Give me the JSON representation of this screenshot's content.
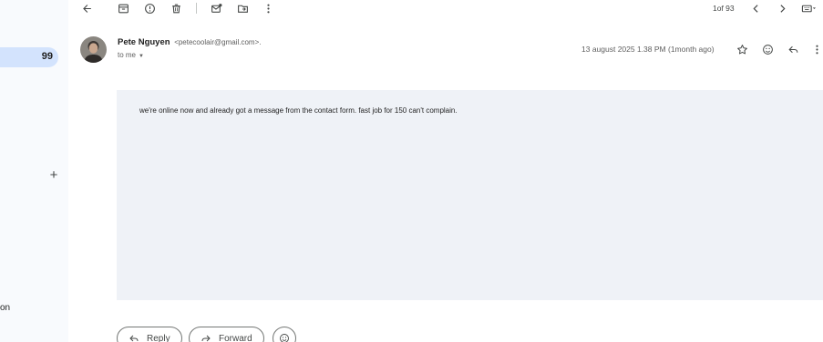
{
  "sidebar": {
    "inbox_count": "99",
    "add_label_glyph": "+",
    "fragment_text": "on"
  },
  "toolbar": {
    "back_icon": "arrow-left-icon",
    "archive_icon": "archive-icon",
    "spam_icon": "report-spam-icon",
    "delete_icon": "trash-icon",
    "mark_unread_icon": "mark-unread-icon",
    "move_icon": "move-to-icon",
    "more_icon": "more-vert-icon",
    "pager_text": "1of 93"
  },
  "email": {
    "sender_name": "Pete Nguyen",
    "sender_email": "<petecoolair@gmail.com>.",
    "to_line": "to me",
    "date": "13 august 2025 1.38 PM (1month ago)",
    "body": "we're online now and already got a message from the contact form. fast job for 150 can't complain."
  },
  "actions": {
    "reply_label": "Reply",
    "forward_label": "Forward"
  },
  "colors": {
    "inbox_highlight": "#d3e3fd",
    "body_background": "#eff2f7",
    "sidebar_background": "#f8fafd"
  }
}
